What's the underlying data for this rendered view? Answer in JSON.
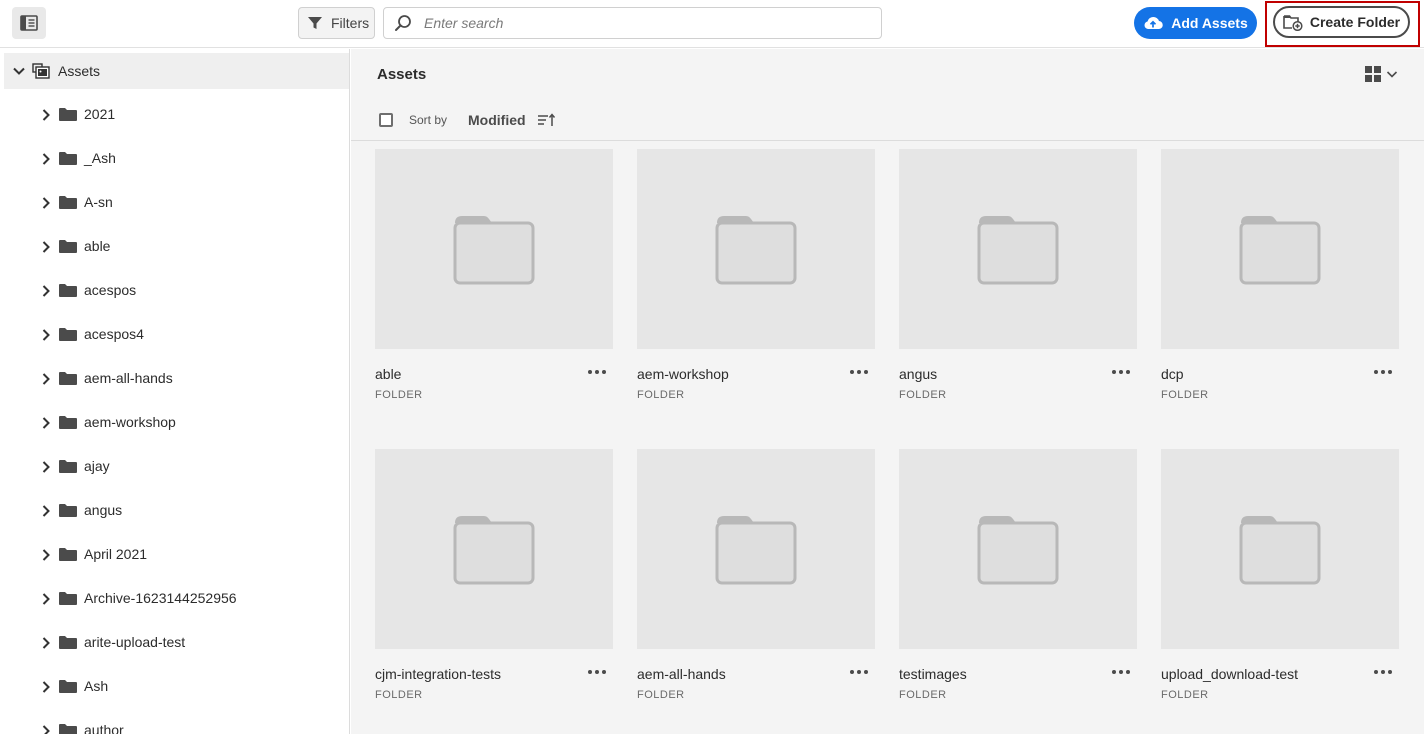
{
  "topbar": {
    "filters_label": "Filters",
    "search_placeholder": "Enter search",
    "add_assets_label": "Add Assets",
    "create_folder_label": "Create Folder"
  },
  "sidebar": {
    "root_label": "Assets",
    "items": [
      {
        "label": "2021"
      },
      {
        "label": "_Ash"
      },
      {
        "label": "A-sn"
      },
      {
        "label": "able"
      },
      {
        "label": "acespos"
      },
      {
        "label": "acespos4"
      },
      {
        "label": "aem-all-hands"
      },
      {
        "label": "aem-workshop"
      },
      {
        "label": "ajay"
      },
      {
        "label": "angus"
      },
      {
        "label": "April 2021"
      },
      {
        "label": "Archive-1623144252956"
      },
      {
        "label": "arite-upload-test"
      },
      {
        "label": "Ash"
      },
      {
        "label": "author"
      }
    ]
  },
  "main": {
    "title": "Assets",
    "sort_by_label": "Sort by",
    "sort_value": "Modified",
    "cards": [
      {
        "name": "able",
        "type": "FOLDER"
      },
      {
        "name": "aem-workshop",
        "type": "FOLDER"
      },
      {
        "name": "angus",
        "type": "FOLDER"
      },
      {
        "name": "dcp",
        "type": "FOLDER"
      },
      {
        "name": "cjm-integration-tests",
        "type": "FOLDER"
      },
      {
        "name": "aem-all-hands",
        "type": "FOLDER"
      },
      {
        "name": "testimages",
        "type": "FOLDER"
      },
      {
        "name": "upload_download-test",
        "type": "FOLDER"
      }
    ]
  },
  "colors": {
    "accent": "#1473e6",
    "highlight": "#c00000"
  }
}
